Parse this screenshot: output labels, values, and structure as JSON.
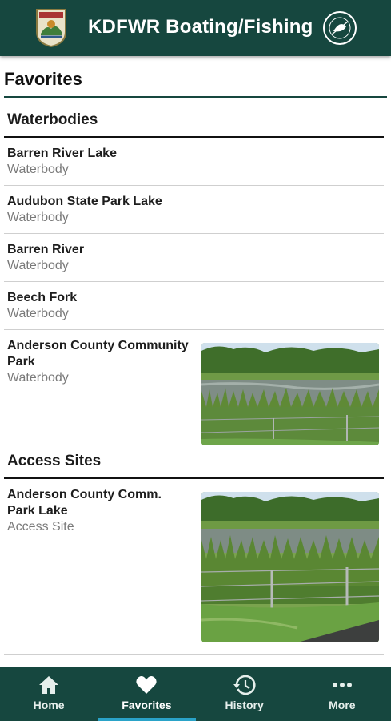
{
  "app": {
    "title": "KDFWR Boating/Fishing"
  },
  "page": {
    "title": "Favorites"
  },
  "sections": {
    "waterbodies": {
      "title": "Waterbodies",
      "items": [
        {
          "name": "Barren River Lake",
          "type": "Waterbody"
        },
        {
          "name": "Audubon State Park Lake",
          "type": "Waterbody"
        },
        {
          "name": "Barren River",
          "type": "Waterbody"
        },
        {
          "name": "Beech Fork",
          "type": "Waterbody"
        },
        {
          "name_line1": "Anderson County Community",
          "name_line2": "Park",
          "type": "Waterbody",
          "image": "pond-photo"
        }
      ]
    },
    "access_sites": {
      "title": "Access Sites",
      "items": [
        {
          "name_line1": "Anderson County Comm.",
          "name_line2": "Park Lake",
          "type": "Access Site",
          "image": "pond-fence-photo"
        }
      ]
    }
  },
  "bottom_nav": {
    "items": [
      {
        "label": "Home",
        "icon": "home-icon",
        "active": false
      },
      {
        "label": "Favorites",
        "icon": "heart-icon",
        "active": true
      },
      {
        "label": "History",
        "icon": "history-icon",
        "active": false
      },
      {
        "label": "More",
        "icon": "more-dots-icon",
        "active": false
      }
    ]
  },
  "colors": {
    "primary": "#16473f",
    "nav_indicator": "#2aa3c8",
    "secondary_text": "#7a7a7a"
  }
}
